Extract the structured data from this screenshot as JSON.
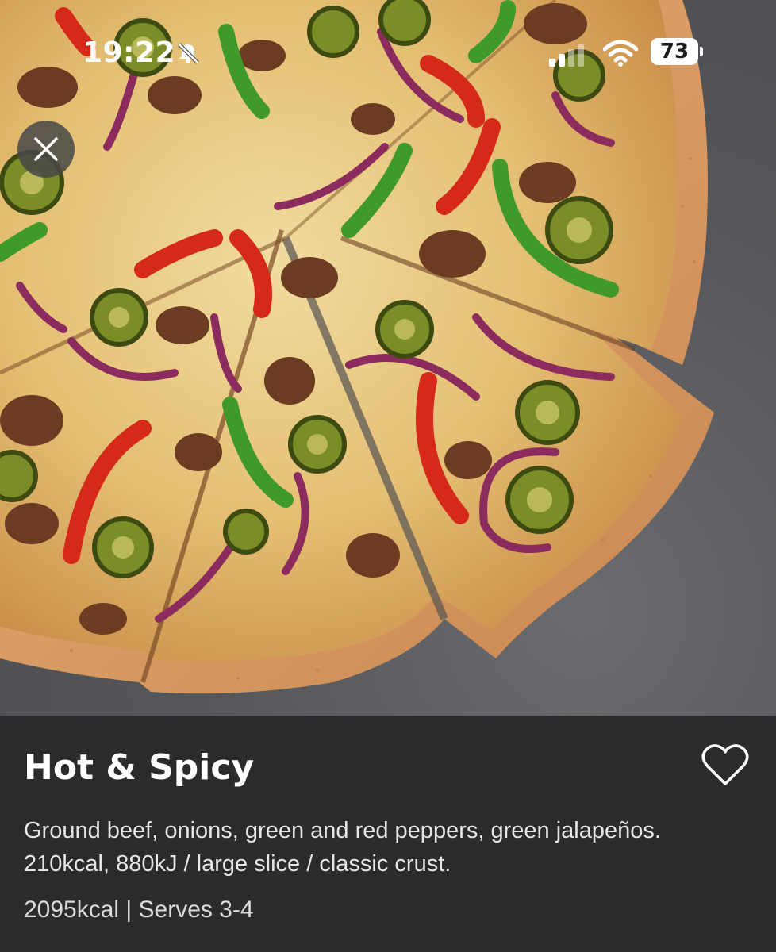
{
  "status_bar": {
    "time": "19:22",
    "battery": "73",
    "icons": [
      "bell-slash-icon",
      "cellular-signal-icon",
      "wifi-icon",
      "battery-icon"
    ]
  },
  "hero": {
    "image": "pizza-photo"
  },
  "controls": {
    "close_icon": "close-icon",
    "favorite_icon": "heart-outline-icon"
  },
  "product": {
    "name": "Hot & Spicy",
    "description_line1": "Ground beef, onions, green and red peppers, green jalapeños.",
    "description_line2": "210kcal, 880kJ / large slice / classic crust.",
    "meta": "2095kcal | Serves 3-4"
  },
  "colors": {
    "panel_background": "#2b2b2c",
    "text_primary": "#ffffff",
    "text_secondary": "#e6e6e6"
  }
}
